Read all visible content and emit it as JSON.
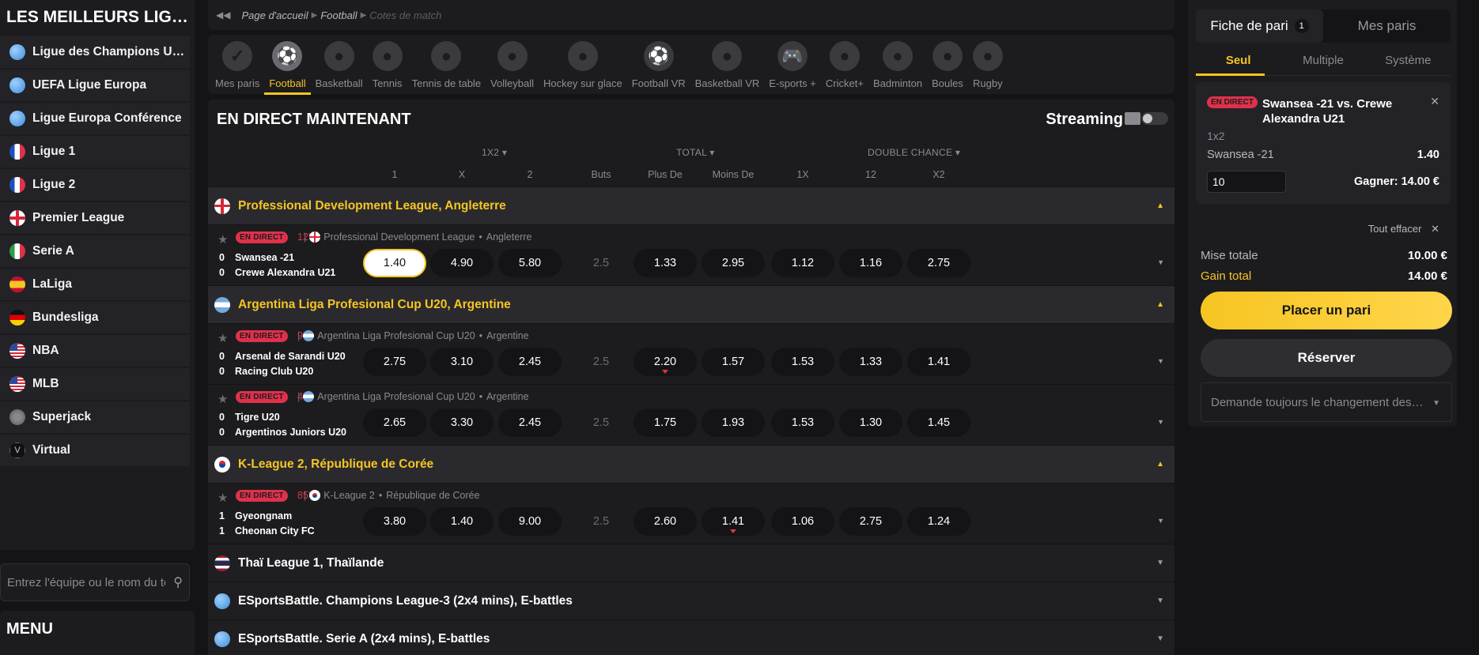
{
  "left": {
    "title": "LES MEILLEURS LIGUES",
    "leagues": [
      {
        "label": "Ligue des Champions UEFA",
        "flag": "world"
      },
      {
        "label": "UEFA Ligue Europa",
        "flag": "world"
      },
      {
        "label": "Ligue Europa Conférence",
        "flag": "world"
      },
      {
        "label": "Ligue 1",
        "flag": "france"
      },
      {
        "label": "Ligue 2",
        "flag": "france"
      },
      {
        "label": "Premier League",
        "flag": "england"
      },
      {
        "label": "Serie A",
        "flag": "italy"
      },
      {
        "label": "LaLiga",
        "flag": "spain"
      },
      {
        "label": "Bundesliga",
        "flag": "germany"
      },
      {
        "label": "NBA",
        "flag": "usa"
      },
      {
        "label": "MLB",
        "flag": "usa"
      },
      {
        "label": "Superjack",
        "flag": "superjack"
      },
      {
        "label": "Virtual",
        "flag": "virtual"
      }
    ],
    "search_placeholder": "Entrez l'équipe ou le nom du tournoi",
    "menu_title": "MENU"
  },
  "breadcrumb": {
    "home": "Page d'accueil",
    "sport": "Football",
    "current": "Cotes de match"
  },
  "sports": [
    {
      "label": "Mes paris",
      "icon": "my-bets-icon",
      "glyph": "✓"
    },
    {
      "label": "Football",
      "icon": "football-icon",
      "glyph": "⚽",
      "active": true
    },
    {
      "label": "Basketball",
      "icon": "basketball-icon",
      "glyph": "●"
    },
    {
      "label": "Tennis",
      "icon": "tennis-icon",
      "glyph": "●"
    },
    {
      "label": "Tennis de table",
      "icon": "table-tennis-icon",
      "glyph": "●"
    },
    {
      "label": "Volleyball",
      "icon": "volleyball-icon",
      "glyph": "●"
    },
    {
      "label": "Hockey sur glace",
      "icon": "ice-hockey-icon",
      "glyph": "●"
    },
    {
      "label": "Football VR",
      "icon": "football-vr-icon",
      "glyph": "⚽"
    },
    {
      "label": "Basketball VR",
      "icon": "basketball-vr-icon",
      "glyph": "●"
    },
    {
      "label": "E-sports +",
      "icon": "gamepad-icon",
      "glyph": "🎮"
    },
    {
      "label": "Cricket+",
      "icon": "cricket-icon",
      "glyph": "●"
    },
    {
      "label": "Badminton",
      "icon": "badminton-icon",
      "glyph": "●"
    },
    {
      "label": "Boules",
      "icon": "boules-icon",
      "glyph": "●"
    },
    {
      "label": "Rugby",
      "icon": "rugby-icon",
      "glyph": "●"
    }
  ],
  "live": {
    "title": "EN DIRECT MAINTENANT",
    "streaming_label": "Streaming",
    "groups": {
      "g1x2": "1X2 ▾",
      "total": "TOTAL ▾",
      "dc": "DOUBLE CHANCE ▾"
    },
    "cols": [
      "1",
      "X",
      "2",
      "Buts",
      "Plus De",
      "Moins De",
      "1X",
      "12",
      "X2"
    ]
  },
  "live_badge": "EN DIRECT",
  "sections": [
    {
      "name": "Professional Development League, Angleterre",
      "flag": "england",
      "expanded": true,
      "matches": [
        {
          "minute": "12'",
          "league": "Professional Development League",
          "country": "Angleterre",
          "home": "Swansea -21",
          "away": "Crewe Alexandra U21",
          "home_score": "0",
          "away_score": "0",
          "odds": [
            "1.40",
            "4.90",
            "5.80"
          ],
          "goals": "2.5",
          "total": [
            "1.33",
            "2.95"
          ],
          "dc": [
            "1.12",
            "1.16",
            "2.75"
          ],
          "selected": 0,
          "trend_up": -1,
          "trend_down": -1
        }
      ]
    },
    {
      "name": "Argentina Liga Profesional Cup U20, Argentine",
      "flag": "argentina",
      "expanded": true,
      "matches": [
        {
          "minute": "9'",
          "league": "Argentina Liga Profesional Cup U20",
          "country": "Argentine",
          "home": "Arsenal de Sarandi U20",
          "away": "Racing Club U20",
          "home_score": "0",
          "away_score": "0",
          "odds": [
            "2.75",
            "3.10",
            "2.45"
          ],
          "goals": "2.5",
          "total": [
            "2.20",
            "1.57"
          ],
          "dc": [
            "1.53",
            "1.33",
            "1.41"
          ],
          "selected": -1,
          "trend_up": 3,
          "trend_down": 4
        },
        {
          "minute": "4'",
          "league": "Argentina Liga Profesional Cup U20",
          "country": "Argentine",
          "home": "Tigre U20",
          "away": "Argentinos Juniors U20",
          "home_score": "0",
          "away_score": "0",
          "odds": [
            "2.65",
            "3.30",
            "2.45"
          ],
          "goals": "2.5",
          "total": [
            "1.75",
            "1.93"
          ],
          "dc": [
            "1.53",
            "1.30",
            "1.45"
          ],
          "selected": -1,
          "trend_up": -1,
          "trend_down": -1
        }
      ]
    },
    {
      "name": "K-League 2, République de Corée",
      "flag": "korea",
      "expanded": true,
      "matches": [
        {
          "minute": "85'",
          "league": "K-League 2",
          "country": "République de Corée",
          "home": "Gyeongnam",
          "away": "Cheonan City FC",
          "home_score": "1",
          "away_score": "1",
          "odds": [
            "3.80",
            "1.40",
            "9.00"
          ],
          "goals": "2.5",
          "total": [
            "2.60",
            "1.41"
          ],
          "dc": [
            "1.06",
            "2.75",
            "1.24"
          ],
          "selected": -1,
          "trend_up": -1,
          "trend_down": 5
        }
      ]
    },
    {
      "name": "Thaï League 1, Thaïlande",
      "flag": "thailand",
      "expanded": false,
      "matches": []
    },
    {
      "name": "ESportsBattle. Champions League-3 (2x4 mins), E-battles",
      "flag": "world",
      "expanded": false,
      "matches": []
    },
    {
      "name": "ESportsBattle. Serie A (2x4 mins), E-battles",
      "flag": "world",
      "expanded": false,
      "matches": []
    }
  ],
  "betslip": {
    "tab_slip": "Fiche de pari",
    "slip_count": "1",
    "tab_mybets": "Mes paris",
    "types": [
      "Seul",
      "Multiple",
      "Système"
    ],
    "bet": {
      "live": "EN DIRECT",
      "match": "Swansea -21 vs. Crewe Alexandra U21",
      "market": "1x2",
      "selection": "Swansea -21",
      "odd": "1.40",
      "stake": "10",
      "win": "Gagner: 14.00 €"
    },
    "clear_all": "Tout effacer",
    "total_stake_label": "Mise totale",
    "total_stake": "10.00 €",
    "total_win_label": "Gain total",
    "total_win": "14.00 €",
    "place_bet": "Placer un pari",
    "reserve": "Réserver",
    "odds_change": "Demande toujours le changement des cotes"
  }
}
